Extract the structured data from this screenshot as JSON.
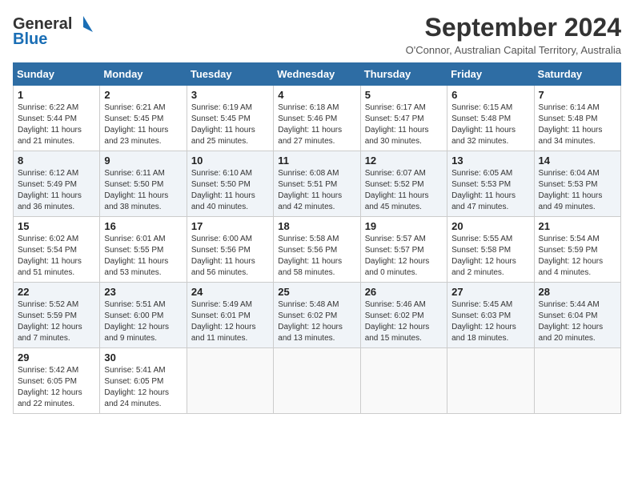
{
  "header": {
    "logo_line1": "General",
    "logo_line2": "Blue",
    "month_year": "September 2024",
    "location": "O'Connor, Australian Capital Territory, Australia"
  },
  "weekdays": [
    "Sunday",
    "Monday",
    "Tuesday",
    "Wednesday",
    "Thursday",
    "Friday",
    "Saturday"
  ],
  "weeks": [
    [
      {
        "day": "1",
        "sunrise": "6:22 AM",
        "sunset": "5:44 PM",
        "daylight": "11 hours and 21 minutes."
      },
      {
        "day": "2",
        "sunrise": "6:21 AM",
        "sunset": "5:45 PM",
        "daylight": "11 hours and 23 minutes."
      },
      {
        "day": "3",
        "sunrise": "6:19 AM",
        "sunset": "5:45 PM",
        "daylight": "11 hours and 25 minutes."
      },
      {
        "day": "4",
        "sunrise": "6:18 AM",
        "sunset": "5:46 PM",
        "daylight": "11 hours and 27 minutes."
      },
      {
        "day": "5",
        "sunrise": "6:17 AM",
        "sunset": "5:47 PM",
        "daylight": "11 hours and 30 minutes."
      },
      {
        "day": "6",
        "sunrise": "6:15 AM",
        "sunset": "5:48 PM",
        "daylight": "11 hours and 32 minutes."
      },
      {
        "day": "7",
        "sunrise": "6:14 AM",
        "sunset": "5:48 PM",
        "daylight": "11 hours and 34 minutes."
      }
    ],
    [
      {
        "day": "8",
        "sunrise": "6:12 AM",
        "sunset": "5:49 PM",
        "daylight": "11 hours and 36 minutes."
      },
      {
        "day": "9",
        "sunrise": "6:11 AM",
        "sunset": "5:50 PM",
        "daylight": "11 hours and 38 minutes."
      },
      {
        "day": "10",
        "sunrise": "6:10 AM",
        "sunset": "5:50 PM",
        "daylight": "11 hours and 40 minutes."
      },
      {
        "day": "11",
        "sunrise": "6:08 AM",
        "sunset": "5:51 PM",
        "daylight": "11 hours and 42 minutes."
      },
      {
        "day": "12",
        "sunrise": "6:07 AM",
        "sunset": "5:52 PM",
        "daylight": "11 hours and 45 minutes."
      },
      {
        "day": "13",
        "sunrise": "6:05 AM",
        "sunset": "5:53 PM",
        "daylight": "11 hours and 47 minutes."
      },
      {
        "day": "14",
        "sunrise": "6:04 AM",
        "sunset": "5:53 PM",
        "daylight": "11 hours and 49 minutes."
      }
    ],
    [
      {
        "day": "15",
        "sunrise": "6:02 AM",
        "sunset": "5:54 PM",
        "daylight": "11 hours and 51 minutes."
      },
      {
        "day": "16",
        "sunrise": "6:01 AM",
        "sunset": "5:55 PM",
        "daylight": "11 hours and 53 minutes."
      },
      {
        "day": "17",
        "sunrise": "6:00 AM",
        "sunset": "5:56 PM",
        "daylight": "11 hours and 56 minutes."
      },
      {
        "day": "18",
        "sunrise": "5:58 AM",
        "sunset": "5:56 PM",
        "daylight": "11 hours and 58 minutes."
      },
      {
        "day": "19",
        "sunrise": "5:57 AM",
        "sunset": "5:57 PM",
        "daylight": "12 hours and 0 minutes."
      },
      {
        "day": "20",
        "sunrise": "5:55 AM",
        "sunset": "5:58 PM",
        "daylight": "12 hours and 2 minutes."
      },
      {
        "day": "21",
        "sunrise": "5:54 AM",
        "sunset": "5:59 PM",
        "daylight": "12 hours and 4 minutes."
      }
    ],
    [
      {
        "day": "22",
        "sunrise": "5:52 AM",
        "sunset": "5:59 PM",
        "daylight": "12 hours and 7 minutes."
      },
      {
        "day": "23",
        "sunrise": "5:51 AM",
        "sunset": "6:00 PM",
        "daylight": "12 hours and 9 minutes."
      },
      {
        "day": "24",
        "sunrise": "5:49 AM",
        "sunset": "6:01 PM",
        "daylight": "12 hours and 11 minutes."
      },
      {
        "day": "25",
        "sunrise": "5:48 AM",
        "sunset": "6:02 PM",
        "daylight": "12 hours and 13 minutes."
      },
      {
        "day": "26",
        "sunrise": "5:46 AM",
        "sunset": "6:02 PM",
        "daylight": "12 hours and 15 minutes."
      },
      {
        "day": "27",
        "sunrise": "5:45 AM",
        "sunset": "6:03 PM",
        "daylight": "12 hours and 18 minutes."
      },
      {
        "day": "28",
        "sunrise": "5:44 AM",
        "sunset": "6:04 PM",
        "daylight": "12 hours and 20 minutes."
      }
    ],
    [
      {
        "day": "29",
        "sunrise": "5:42 AM",
        "sunset": "6:05 PM",
        "daylight": "12 hours and 22 minutes."
      },
      {
        "day": "30",
        "sunrise": "5:41 AM",
        "sunset": "6:05 PM",
        "daylight": "12 hours and 24 minutes."
      },
      null,
      null,
      null,
      null,
      null
    ]
  ]
}
